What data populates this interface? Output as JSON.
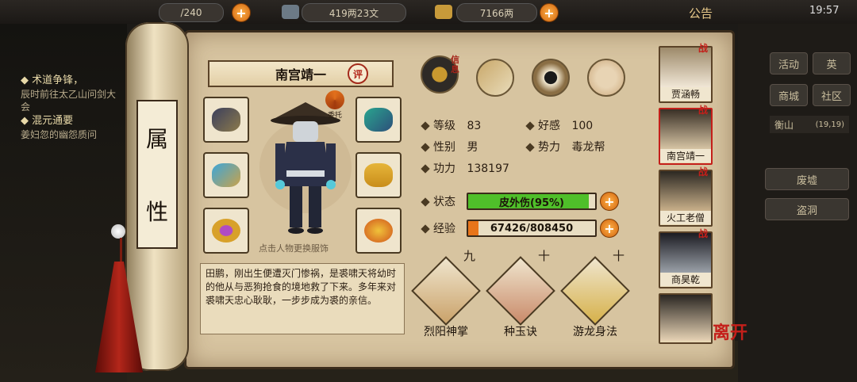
{
  "topbar": {
    "stamina": "/240",
    "coins": "419两23文",
    "silver": "7166两",
    "announce_label": "公告",
    "time": "19:57"
  },
  "quests": [
    {
      "title": "术道争锋，",
      "desc": "辰时前往太乙山问剑大会"
    },
    {
      "title": "混元通要",
      "desc": "姜妇忽的幽怨质问"
    }
  ],
  "right_menu": {
    "row1": [
      "活动",
      "英"
    ],
    "row2": [
      "商城",
      "社区"
    ],
    "location": "衡山",
    "coords": "(19,19)",
    "places": [
      "废墟",
      "盗洞"
    ]
  },
  "scroll_label": [
    "属",
    "性"
  ],
  "character": {
    "name": "南宫靖一",
    "review_label": "评",
    "entrust_label": "委托",
    "change_hint": "点击人物更换服饰",
    "bio": "田鹏，刚出生便遭灭门惨祸，是裘啸天将幼时的他从与恶狗抢食的境地救了下来。多年来对裘啸天忠心耿耿，一步步成为裘的亲信。",
    "info_tab_label": "信息",
    "stats": {
      "level_label": "等级",
      "level": "83",
      "favor_label": "好感",
      "favor": "100",
      "gender_label": "性别",
      "gender": "男",
      "faction_label": "势力",
      "faction": "毒龙帮",
      "power_label": "功力",
      "power": "138197"
    },
    "status": {
      "label": "状态",
      "text": "皮外伤(95%)",
      "fraction": 0.95,
      "color": "#4fbf2a"
    },
    "exp": {
      "label": "经验",
      "text": "67426/808450",
      "fraction": 0.0834,
      "color": "#e8751a"
    }
  },
  "skills": [
    {
      "name": "烈阳神掌",
      "level": "九"
    },
    {
      "name": "种玉诀",
      "level": "十"
    },
    {
      "name": "游龙身法",
      "level": "十"
    }
  ],
  "roster": [
    {
      "name": "贾涵畅",
      "badge": "战"
    },
    {
      "name": "南宫靖一",
      "badge": "战"
    },
    {
      "name": "火工老僧",
      "badge": "战"
    },
    {
      "name": "商昊乾",
      "badge": "战"
    },
    {
      "name": "",
      "badge": ""
    }
  ],
  "leave_label": "离开",
  "icons": {
    "plus": "plus-icon",
    "equip": [
      "bracer-icon",
      "scarf-icon",
      "amulet-icon",
      "robe-icon",
      "ring-icon",
      "belt-icon"
    ],
    "tabs": [
      "info-icon",
      "map-icon",
      "bagua-icon",
      "meridian-icon"
    ]
  },
  "colors": {
    "accent": "#c41f1a",
    "panel": "#d7c4a0"
  }
}
